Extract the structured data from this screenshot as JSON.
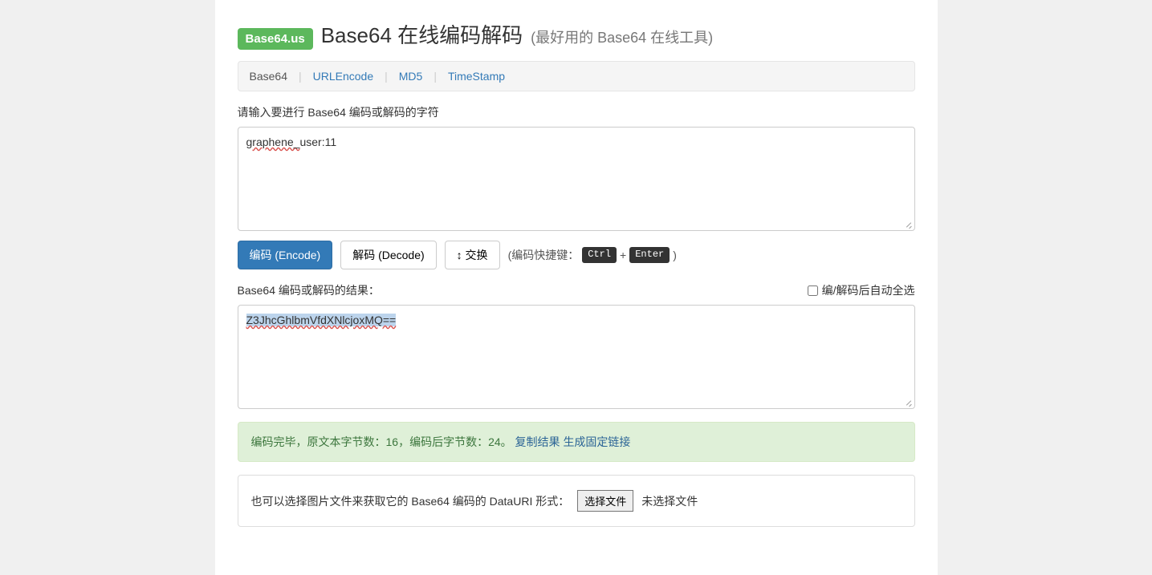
{
  "header": {
    "badge": "Base64.us",
    "title": "Base64 在线编码解码",
    "subtitle": "(最好用的 Base64 在线工具)"
  },
  "nav": {
    "items": [
      "Base64",
      "URLEncode",
      "MD5",
      "TimeStamp"
    ],
    "active_index": 0
  },
  "input": {
    "label": "请输入要进行 Base64 编码或解码的字符",
    "value_part1": "graphene_",
    "value_part2": "user:11"
  },
  "buttons": {
    "encode": "编码 (Encode)",
    "decode": "解码 (Decode)",
    "swap": "↕ 交换"
  },
  "shortcut": {
    "prefix": "(编码快捷键：",
    "key1": "Ctrl",
    "plus": "+",
    "key2": "Enter",
    "suffix": ")"
  },
  "result": {
    "label": "Base64 编码或解码的结果：",
    "auto_select_label": "编/解码后自动全选",
    "value": "Z3JhcGhlbmVfdXNlcjoxMQ=="
  },
  "alert": {
    "status_text": "编码完毕，原文本字节数：16，编码后字节数：24。",
    "copy_link": "复制结果",
    "gen_link": "生成固定链接"
  },
  "file_panel": {
    "text": "也可以选择图片文件来获取它的 Base64 编码的 DataURI 形式：",
    "button": "选择文件",
    "status": "未选择文件"
  }
}
